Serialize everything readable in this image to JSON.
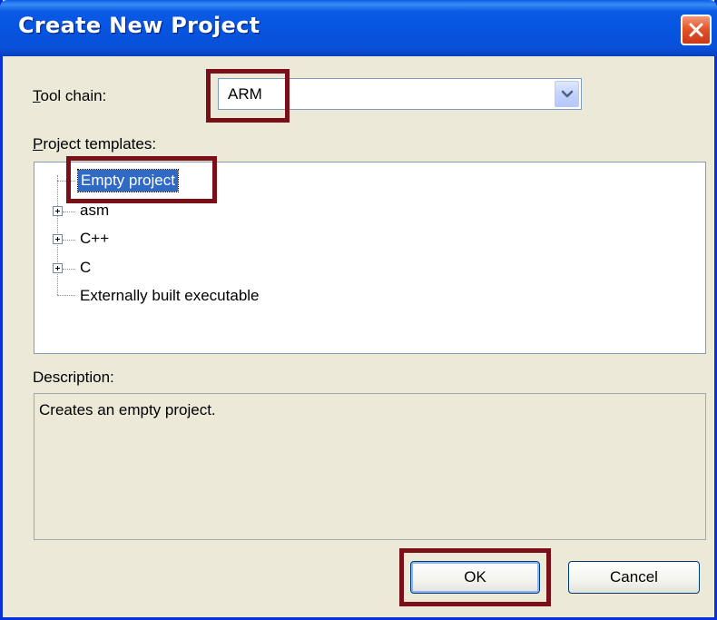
{
  "window": {
    "title": "Create New Project"
  },
  "toolchain": {
    "label_first": "T",
    "label_rest": "ool chain:",
    "value": "ARM"
  },
  "templates": {
    "label_first": "P",
    "label_rest": "roject templates:",
    "items": [
      {
        "label": "Empty project",
        "expandable": false,
        "selected": true
      },
      {
        "label": "asm",
        "expandable": true,
        "selected": false
      },
      {
        "label": "C++",
        "expandable": true,
        "selected": false
      },
      {
        "label": "C",
        "expandable": true,
        "selected": false
      },
      {
        "label": "Externally built executable",
        "expandable": false,
        "selected": false
      }
    ]
  },
  "description": {
    "label": "Description:",
    "text": "Creates an empty project."
  },
  "buttons": {
    "ok": "OK",
    "cancel": "Cancel"
  },
  "colors": {
    "highlight_border": "#7b0f18",
    "selection": "#316ac5",
    "titlebar": "#0654e0"
  },
  "icons": {
    "close": "close-icon",
    "dropdown": "chevron-down-icon",
    "expand": "plus-expander-icon"
  }
}
